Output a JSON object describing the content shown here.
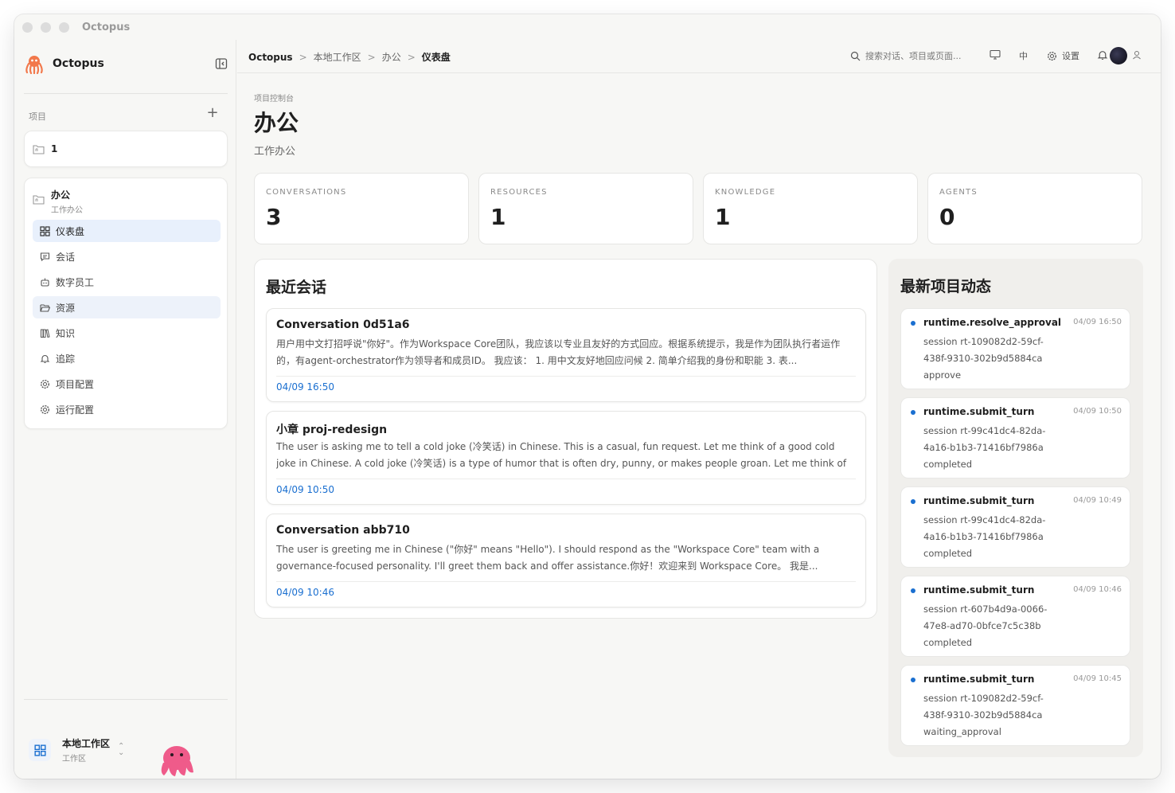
{
  "window": {
    "title": "Octopus"
  },
  "sidebar": {
    "brand": "Octopus",
    "projects_label": "项目",
    "project_1": {
      "name": "1"
    },
    "current_project": {
      "name": "办公",
      "subtitle": "工作办公"
    },
    "nav": [
      {
        "label": "仪表盘",
        "icon": "dashboard-icon"
      },
      {
        "label": "会话",
        "icon": "chat-icon"
      },
      {
        "label": "数字员工",
        "icon": "robot-icon"
      },
      {
        "label": "资源",
        "icon": "folder-open-icon"
      },
      {
        "label": "知识",
        "icon": "books-icon"
      },
      {
        "label": "追踪",
        "icon": "bell-icon"
      },
      {
        "label": "项目配置",
        "icon": "gear-icon"
      },
      {
        "label": "运行配置",
        "icon": "gear-icon"
      }
    ],
    "workspace": {
      "name": "本地工作区",
      "type": "工作区"
    }
  },
  "topbar": {
    "breadcrumb": [
      "Octopus",
      "本地工作区",
      "办公",
      "仪表盘"
    ],
    "separator": ">",
    "search_placeholder": "搜索对话、项目或页面...",
    "lang": "中",
    "settings_label": "设置"
  },
  "page": {
    "kicker": "项目控制台",
    "title": "办公",
    "subtitle": "工作办公"
  },
  "stats": [
    {
      "label": "CONVERSATIONS",
      "value": "3"
    },
    {
      "label": "RESOURCES",
      "value": "1"
    },
    {
      "label": "KNOWLEDGE",
      "value": "1"
    },
    {
      "label": "AGENTS",
      "value": "0"
    }
  ],
  "recent": {
    "title": "最近会话",
    "items": [
      {
        "title": "Conversation 0d51a6",
        "body": "用户用中文打招呼说\"你好\"。作为Workspace Core团队，我应该以专业且友好的方式回应。根据系统提示，我是作为团队执行者运作的，有agent-orchestrator作为领导者和成员ID。 我应该： 1. 用中文友好地回应问候 2. 简单介绍我的身份和职能 3. 表...",
        "date": "04/09 16:50"
      },
      {
        "title": "小章 proj-redesign",
        "body": "The user is asking me to tell a cold joke (冷笑话) in Chinese. This is a casual, fun request. Let me think of a good cold joke in Chinese. A cold joke (冷笑话) is a type of humor that is often dry, punny, or makes people groan. Let me think of ...",
        "date": "04/09 10:50"
      },
      {
        "title": "Conversation abb710",
        "body": "The user is greeting me in Chinese (\"你好\" means \"Hello\"). I should respond as the \"Workspace Core\" team with a governance-focused personality. I'll greet them back and offer assistance.你好！欢迎来到 Workspace Core。 我是...",
        "date": "04/09 10:46"
      }
    ]
  },
  "activity": {
    "title": "最新项目动态",
    "items": [
      {
        "name": "runtime.resolve_approval",
        "time": "04/09 16:50",
        "detail": "session rt-109082d2-59cf-438f-9310-302b9d5884ca",
        "status": "approve"
      },
      {
        "name": "runtime.submit_turn",
        "time": "04/09 10:50",
        "detail": "session rt-99c41dc4-82da-4a16-b1b3-71416bf7986a",
        "status": "completed"
      },
      {
        "name": "runtime.submit_turn",
        "time": "04/09 10:49",
        "detail": "session rt-99c41dc4-82da-4a16-b1b3-71416bf7986a",
        "status": "completed"
      },
      {
        "name": "runtime.submit_turn",
        "time": "04/09 10:46",
        "detail": "session rt-607b4d9a-0066-47e8-ad70-0bfce7c5c38b",
        "status": "completed"
      },
      {
        "name": "runtime.submit_turn",
        "time": "04/09 10:45",
        "detail": "session rt-109082d2-59cf-438f-9310-302b9d5884ca",
        "status": "waiting_approval"
      }
    ]
  },
  "colors": {
    "accent": "#1a6fd0",
    "active_nav": "#e8f0fc",
    "mascot": "#ef5b8a"
  }
}
